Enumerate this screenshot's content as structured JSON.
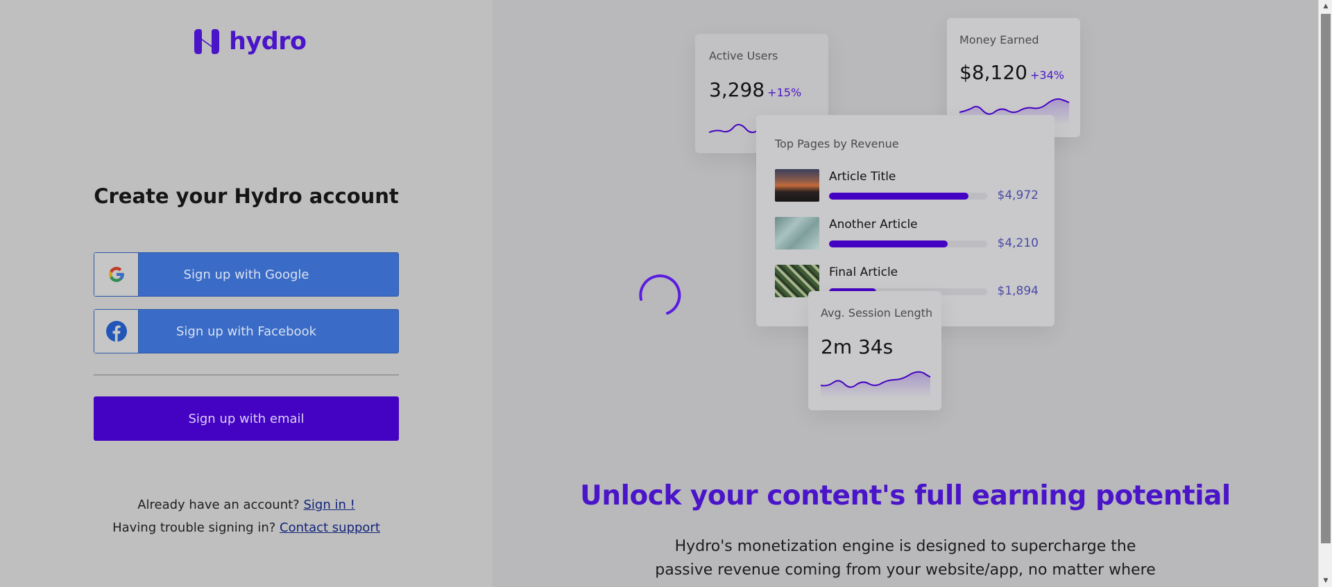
{
  "brand": {
    "name": "hydro",
    "color": "#4a14c9"
  },
  "signup": {
    "heading": "Create your Hydro account",
    "google_label": "Sign up with Google",
    "facebook_label": "Sign up with Facebook",
    "email_label": "Sign up with email"
  },
  "footer": {
    "have_account": "Already have an account?",
    "sign_in_link": "Sign in !",
    "trouble": "Having trouble signing in?",
    "support_link": "Contact support"
  },
  "dashboard": {
    "active_users": {
      "title": "Active Users",
      "value": "3,298",
      "delta": "+15%"
    },
    "money_earned": {
      "title": "Money Earned",
      "value": "$8,120",
      "delta": "+34%"
    },
    "top_pages": {
      "title": "Top Pages by Revenue",
      "rows": [
        {
          "name": "Article Title",
          "amount": "$4,972",
          "fraction": 0.88
        },
        {
          "name": "Another Article",
          "amount": "$4,210",
          "fraction": 0.75
        },
        {
          "name": "Final Article",
          "amount": "$1,894",
          "fraction": 0.3
        }
      ]
    },
    "session": {
      "title": "Avg. Session Length",
      "value": "2m 34s"
    }
  },
  "marketing": {
    "headline": "Unlock your content's full earning potential",
    "body": "Hydro's monetization engine is designed to supercharge the passive revenue coming from your website/app, no matter where your users are"
  },
  "colors": {
    "accent": "#4402c2",
    "social_button": "#3a6bc6"
  },
  "icons": [
    "hydro-logo-icon",
    "google-icon",
    "facebook-icon",
    "loading-spinner-icon"
  ]
}
